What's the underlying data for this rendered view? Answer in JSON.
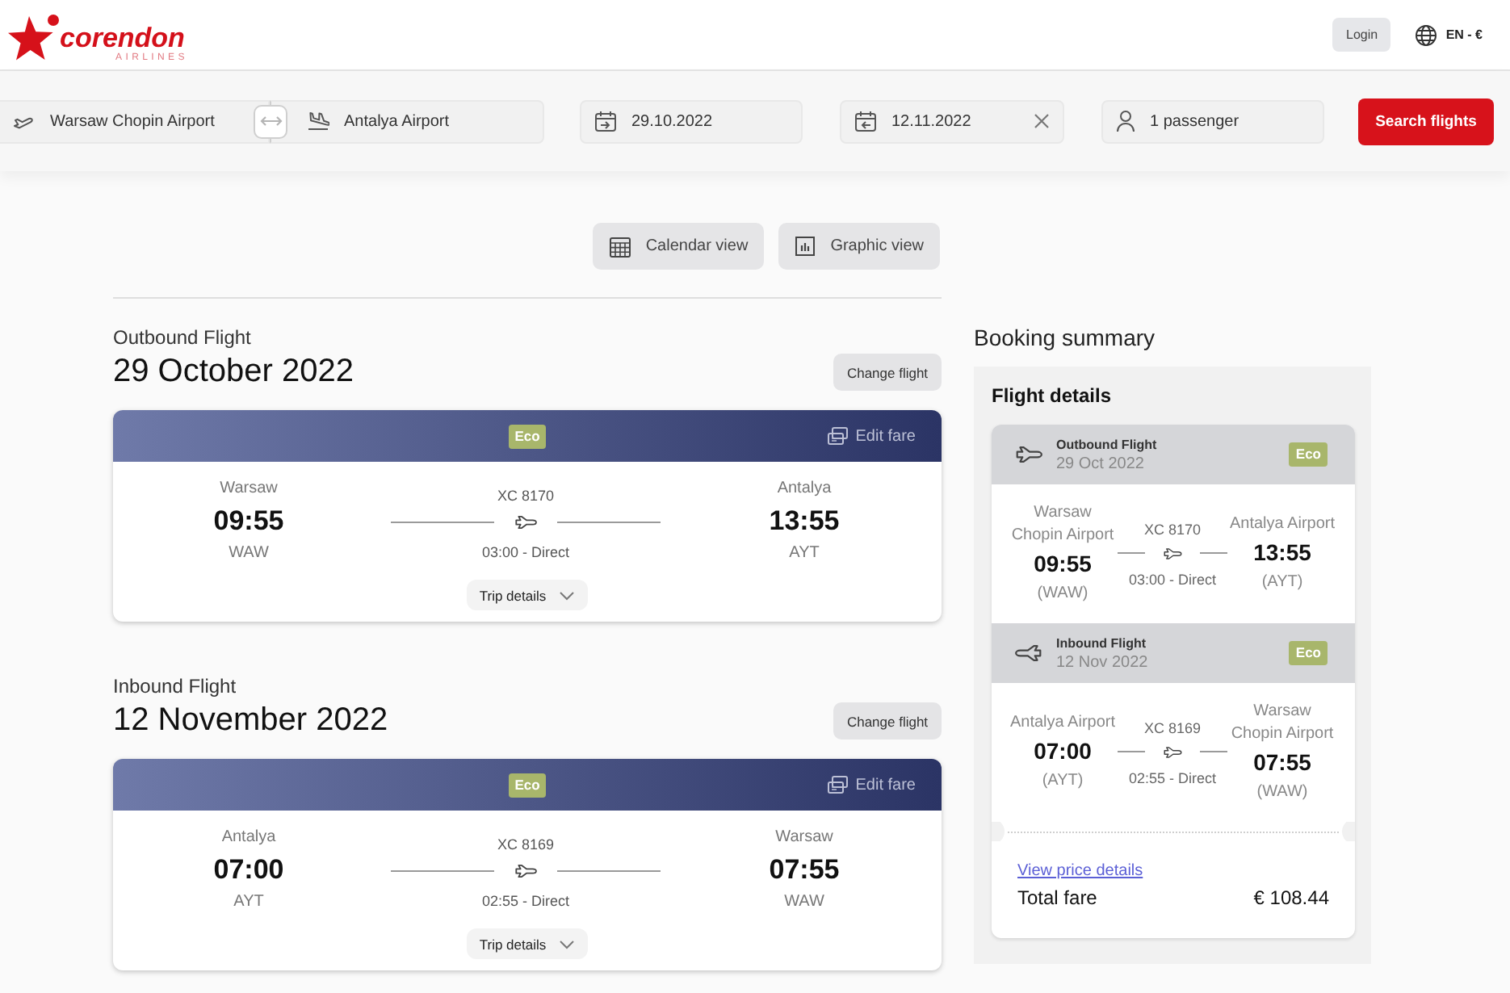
{
  "header": {
    "logo": {
      "brand": "corendon",
      "tagline": "AIRLINES"
    },
    "login": "Login",
    "language": "EN - €"
  },
  "search": {
    "origin": "Warsaw Chopin Airport",
    "destination": "Antalya Airport",
    "departure_date": "29.10.2022",
    "return_date": "12.11.2022",
    "passengers": "1 passenger",
    "submit": "Search flights"
  },
  "view_buttons": [
    {
      "kind": "calendar",
      "label": "Calendar view"
    },
    {
      "kind": "graphic",
      "label": "Graphic view"
    }
  ],
  "flights": [
    {
      "heading": "Outbound Flight",
      "date": "29 October 2022",
      "change_button": "Change flight",
      "fare_class": "Eco",
      "edit_fare": "Edit fare",
      "departure": {
        "city": "Warsaw",
        "time": "09:55",
        "code": "WAW"
      },
      "flight_number": "XC 8170",
      "duration": "03:00 - Direct",
      "arrival": {
        "city": "Antalya",
        "time": "13:55",
        "code": "AYT"
      },
      "details_button": "Trip details"
    },
    {
      "heading": "Inbound Flight",
      "date": "12 November 2022",
      "change_button": "Change flight",
      "fare_class": "Eco",
      "edit_fare": "Edit fare",
      "departure": {
        "city": "Antalya",
        "time": "07:00",
        "code": "AYT"
      },
      "flight_number": "XC 8169",
      "duration": "02:55 - Direct",
      "arrival": {
        "city": "Warsaw",
        "time": "07:55",
        "code": "WAW"
      },
      "details_button": "Trip details"
    }
  ],
  "summary": {
    "title": "Booking summary",
    "panel_title": "Flight details",
    "legs": [
      {
        "kind": "outbound",
        "label": "Outbound Flight",
        "date": "29 Oct 2022",
        "fare_class": "Eco",
        "departure": {
          "airport": "Warsaw Chopin Airport",
          "time": "09:55",
          "code": "(WAW)"
        },
        "flight_number": "XC 8170",
        "duration": "03:00 - Direct",
        "arrival": {
          "airport": "Antalya Airport",
          "time": "13:55",
          "code": "(AYT)"
        }
      },
      {
        "kind": "inbound",
        "label": "Inbound Flight",
        "date": "12 Nov 2022",
        "fare_class": "Eco",
        "departure": {
          "airport": "Antalya Airport",
          "time": "07:00",
          "code": "(AYT)"
        },
        "flight_number": "XC 8169",
        "duration": "02:55 - Direct",
        "arrival": {
          "airport": "Warsaw Chopin Airport",
          "time": "07:55",
          "code": "(WAW)"
        }
      }
    ],
    "price_link": "View price details",
    "total_label": "Total fare",
    "total": "€ 108.44"
  }
}
